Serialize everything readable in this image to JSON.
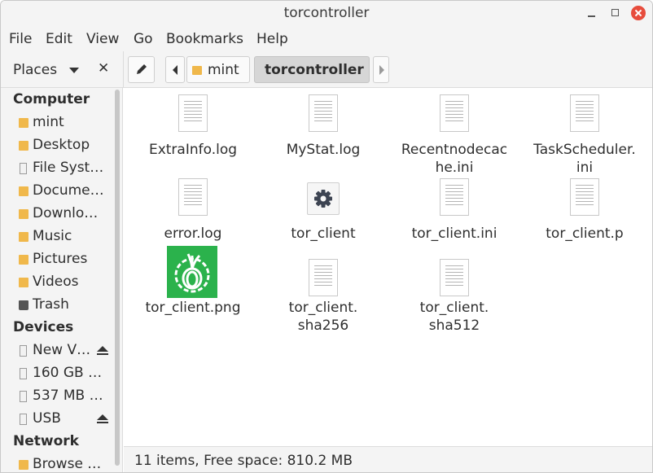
{
  "window": {
    "title": "torcontroller"
  },
  "menu": [
    "File",
    "Edit",
    "View",
    "Go",
    "Bookmarks",
    "Help"
  ],
  "sidebar": {
    "header": "Places",
    "sections": {
      "computer": "Computer",
      "devices": "Devices",
      "network": "Network"
    },
    "computer_items": [
      {
        "label": "mint",
        "icon": "home-folder-icon"
      },
      {
        "label": "Desktop",
        "icon": "folder-icon"
      },
      {
        "label": "File Syst…",
        "icon": "drive-icon"
      },
      {
        "label": "Docume…",
        "icon": "documents-folder-icon"
      },
      {
        "label": "Downlo…",
        "icon": "downloads-folder-icon"
      },
      {
        "label": "Music",
        "icon": "music-folder-icon"
      },
      {
        "label": "Pictures",
        "icon": "pictures-folder-icon"
      },
      {
        "label": "Videos",
        "icon": "videos-folder-icon"
      },
      {
        "label": "Trash",
        "icon": "trash-icon"
      }
    ],
    "device_items": [
      {
        "label": "New V…",
        "icon": "drive-icon",
        "eject": true
      },
      {
        "label": "160 GB …",
        "icon": "drive-icon",
        "eject": false
      },
      {
        "label": "537 MB …",
        "icon": "drive-icon",
        "eject": false
      },
      {
        "label": "USB",
        "icon": "drive-icon",
        "eject": true
      }
    ],
    "network_items": [
      {
        "label": "Browse …",
        "icon": "network-icon"
      }
    ]
  },
  "toolbar": {
    "breadcrumbs": [
      "mint",
      "torcontroller"
    ]
  },
  "files": [
    {
      "name_lines": [
        "ExtraInfo.log"
      ],
      "icon": "text-file-icon"
    },
    {
      "name_lines": [
        "MyStat.log"
      ],
      "icon": "text-file-icon"
    },
    {
      "name_lines": [
        "Recentnodecac",
        "he.ini"
      ],
      "icon": "text-file-icon"
    },
    {
      "name_lines": [
        "TaskScheduler.",
        "ini"
      ],
      "icon": "text-file-icon"
    },
    {
      "name_lines": [
        "error.log"
      ],
      "icon": "text-file-icon"
    },
    {
      "name_lines": [
        "tor_client"
      ],
      "icon": "executable-gear-icon"
    },
    {
      "name_lines": [
        "tor_client.ini"
      ],
      "icon": "text-file-icon"
    },
    {
      "name_lines": [
        "tor_client.p"
      ],
      "icon": "text-file-icon"
    },
    {
      "name_lines": [
        "tor_client.png"
      ],
      "icon": "tor-onion-image-icon"
    },
    {
      "name_lines": [
        "tor_client.",
        "sha256"
      ],
      "icon": "text-file-icon"
    },
    {
      "name_lines": [
        "tor_client.",
        "sha512"
      ],
      "icon": "text-file-icon"
    }
  ],
  "status": {
    "text": "11 items, Free space: 810.2 MB"
  },
  "colors": {
    "tor_green": "#2bb24c",
    "folder": "#f0b84b",
    "close_button": "#e74c3c"
  }
}
